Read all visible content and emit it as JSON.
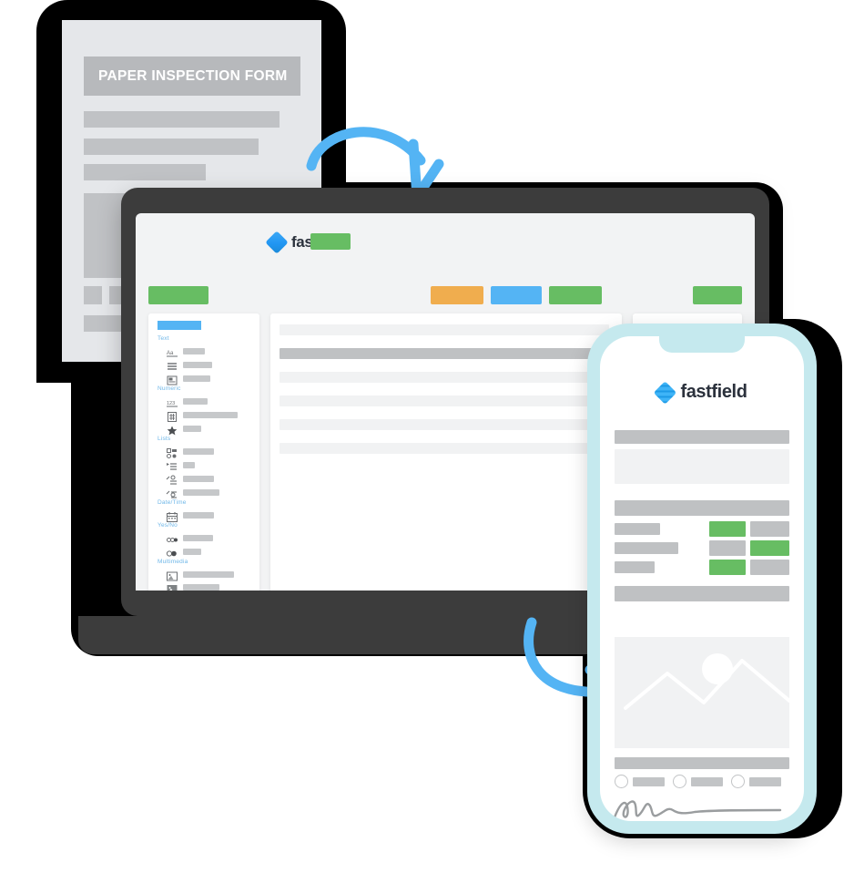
{
  "scene": {
    "title": "Paper inspection form to FastField digital form conversion illustration",
    "colors": {
      "green": "#67bd63",
      "orange": "#f0ad4e",
      "blue": "#54b4f4",
      "arrow_blue": "#54b4f4",
      "brand_dark": "#2b313c",
      "phone_frame": "#c5e9ee",
      "laptop_shell": "#3c3c3c",
      "paper_bg": "#e5e7ea",
      "placeholder_gray": "#c2c4c6",
      "backdrop": "#000000"
    }
  },
  "paper_form": {
    "title": "PAPER INSPECTION FORM"
  },
  "laptop": {
    "brand": {
      "wordmark": "fastfield",
      "logo_icon": "fastfield-diamond-logo-icon"
    },
    "palette": {
      "categories": [
        {
          "label": "Text",
          "fields": [
            {
              "icon": "text-aa-icon"
            },
            {
              "icon": "multiline-text-icon"
            },
            {
              "icon": "rich-text-icon"
            }
          ]
        },
        {
          "label": "Numeric",
          "fields": [
            {
              "icon": "number-123-icon"
            },
            {
              "icon": "calculation-icon"
            },
            {
              "icon": "rating-star-icon"
            }
          ]
        },
        {
          "label": "Lists",
          "fields": [
            {
              "icon": "checkbox-list-icon"
            },
            {
              "icon": "dropdown-list-icon"
            },
            {
              "icon": "single-select-icon"
            },
            {
              "icon": "multi-select-icon"
            }
          ]
        },
        {
          "label": "Date/Time",
          "fields": [
            {
              "icon": "calendar-icon"
            }
          ]
        },
        {
          "label": "Yes/No",
          "fields": [
            {
              "icon": "toggle-switch-icon"
            },
            {
              "icon": "radio-toggle-icon"
            }
          ]
        },
        {
          "label": "Multimedia",
          "fields": [
            {
              "icon": "image-icon"
            },
            {
              "icon": "photo-icon"
            },
            {
              "icon": "image-stack-icon"
            },
            {
              "icon": "video-camera-icon"
            },
            {
              "icon": "signature-pen-icon"
            }
          ]
        }
      ]
    },
    "toolbar": {
      "buttons": [
        {
          "name": "primary-action",
          "color": "#67bd63"
        },
        {
          "name": "warning-action",
          "color": "#f0ad4e"
        },
        {
          "name": "info-action",
          "color": "#54b4f4"
        },
        {
          "name": "success-action",
          "color": "#67bd63"
        },
        {
          "name": "save-action",
          "color": "#67bd63"
        }
      ]
    },
    "canvas": {
      "rows": [
        {
          "selected": false
        },
        {
          "selected": true
        },
        {
          "selected": false
        },
        {
          "selected": false
        },
        {
          "selected": false
        },
        {
          "selected": false
        }
      ]
    },
    "inspector": {
      "rows": 4
    }
  },
  "phone": {
    "brand": {
      "wordmark": "fastfield",
      "logo_icon": "fastfield-diamond-logo-icon"
    },
    "sections": [
      {
        "type": "header-bar"
      },
      {
        "type": "text-area"
      },
      {
        "type": "header-bar"
      },
      {
        "type": "choice-rows",
        "rows": [
          {
            "selected_index": 0
          },
          {
            "selected_index": 1
          },
          {
            "selected_index": 0
          }
        ]
      },
      {
        "type": "header-bar"
      },
      {
        "type": "image-capture",
        "icon": "image-placeholder-icon"
      },
      {
        "type": "label-bar"
      },
      {
        "type": "radio-group",
        "options": 3
      },
      {
        "type": "signature",
        "icon": "handwritten-signature-icon"
      }
    ]
  },
  "arrows": [
    {
      "name": "arrow-paper-to-laptop",
      "direction": "down-right",
      "color": "#54b4f4"
    },
    {
      "name": "arrow-laptop-to-phone",
      "direction": "right-down",
      "color": "#54b4f4"
    }
  ]
}
